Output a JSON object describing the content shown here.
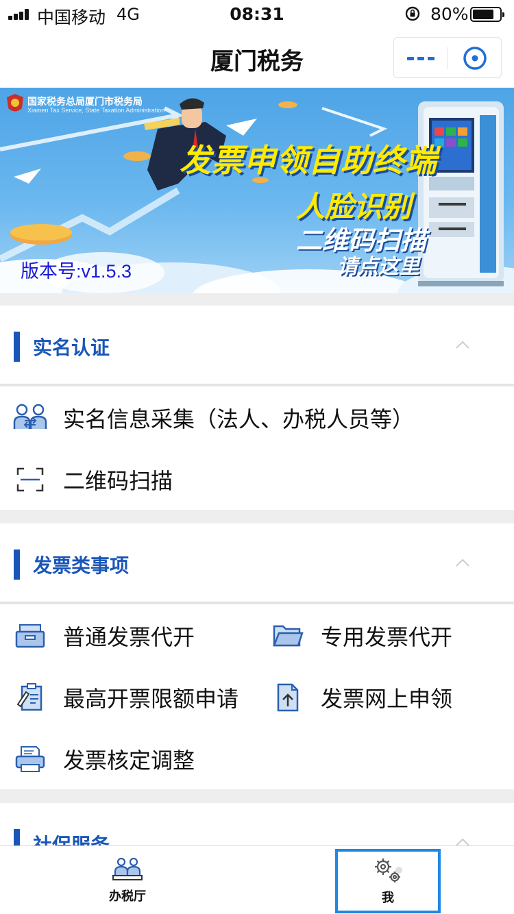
{
  "status_bar": {
    "carrier": "中国移动",
    "network": "4G",
    "time": "08:31",
    "battery_percent": "80%",
    "battery_level": 0.8
  },
  "nav": {
    "title": "厦门税务"
  },
  "banner": {
    "org_name": "国家税务总局厦门市税务局",
    "org_name_en": "Xiamen Tax Service, State Taxation Administration",
    "headline_1": "发票申领自助终端",
    "headline_2": "人脸识别",
    "headline_3": "二维码扫描",
    "cta": "请点这里",
    "version": "版本号:v1.5.3"
  },
  "sections": {
    "realname": {
      "title": "实名认证",
      "items": [
        {
          "label": "实名信息采集（法人、办税人员等）",
          "icon": "users-exchange-icon"
        },
        {
          "label": "二维码扫描",
          "icon": "scan-icon"
        }
      ]
    },
    "invoice": {
      "title": "发票类事项",
      "items": [
        {
          "label": "普通发票代开",
          "icon": "inbox-tray-icon"
        },
        {
          "label": "专用发票代开",
          "icon": "folder-open-icon"
        },
        {
          "label": "最高开票限额申请",
          "icon": "clipboard-edit-icon"
        },
        {
          "label": "发票网上申领",
          "icon": "document-upload-icon"
        },
        {
          "label": "发票核定调整",
          "icon": "printer-icon"
        }
      ]
    },
    "social": {
      "title": "社保服务"
    }
  },
  "tab_bar": {
    "tabs": [
      {
        "label": "办税厅",
        "icon": "service-hall-icon"
      },
      {
        "label": "我",
        "icon": "settings-gears-icon"
      }
    ]
  },
  "colors": {
    "accent": "#1a56b8",
    "version_text": "#1a1ad6",
    "tab_highlight": "#1e88e5",
    "banner_yellow": "#ffea00"
  }
}
